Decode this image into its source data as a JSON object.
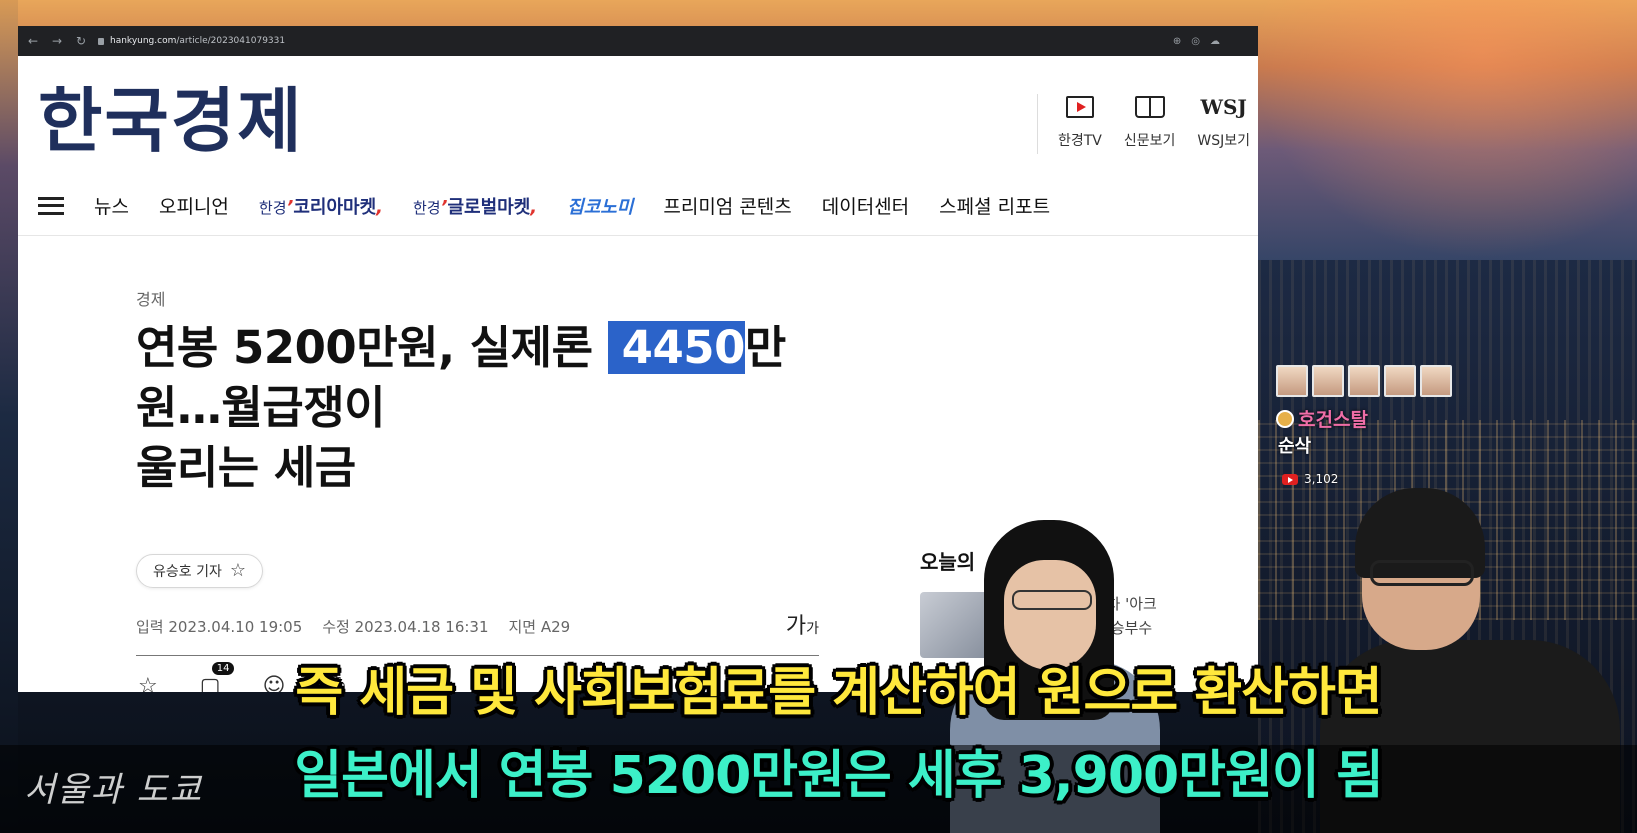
{
  "browser": {
    "url_host": "hankyung.com",
    "url_path": "/article/2023041079331",
    "icons": [
      "zoom-icon",
      "eye-off-icon",
      "cloud-icon"
    ]
  },
  "site": {
    "logo": "한국경제",
    "header_links": [
      {
        "label": "한경TV",
        "icon": "tv-icon"
      },
      {
        "label": "신문보기",
        "icon": "newspaper-icon"
      },
      {
        "label": "WSJ보기",
        "icon_text": "WSJ"
      }
    ]
  },
  "gnb": {
    "items": [
      "뉴스",
      "오피니언"
    ],
    "brand1_pre": "한경",
    "brand1": "코리아마켓",
    "brand2_pre": "한경",
    "brand2": "글로벌마켓",
    "brand3": "집코노미",
    "items2": [
      "프리미엄 콘텐츠",
      "데이터센터",
      "스페셜 리포트"
    ]
  },
  "article": {
    "section": "경제",
    "headline_a": "연봉 5200만원, 실제론",
    "headline_highlight": "4450",
    "headline_b": "만원…월급쟁이",
    "headline_line2": "울리는 세금",
    "reporter": "유승호 기자",
    "input_date": "입력 2023.04.10 19:05",
    "modified_date": "수정 2023.04.18 16:31",
    "page": "지면 A29",
    "font_size_label": "가",
    "font_size_small": "가",
    "comment_count": "14"
  },
  "side": {
    "title": "오늘의",
    "line1": "대차, 中 전기차 '아크",
    "line2": "든다…재도약 승부수"
  },
  "overlay": {
    "streamer_name": "호건스탈",
    "streamer_sub": "순삭",
    "views": "3,102"
  },
  "captions": {
    "line1": "즉 세금 및 사회보험료를 계산하여 원으로 환산하면",
    "line2": "일본에서 연봉 5200만원은 세후 3,900만원이 됨",
    "handwritten": "서울과 도쿄"
  }
}
